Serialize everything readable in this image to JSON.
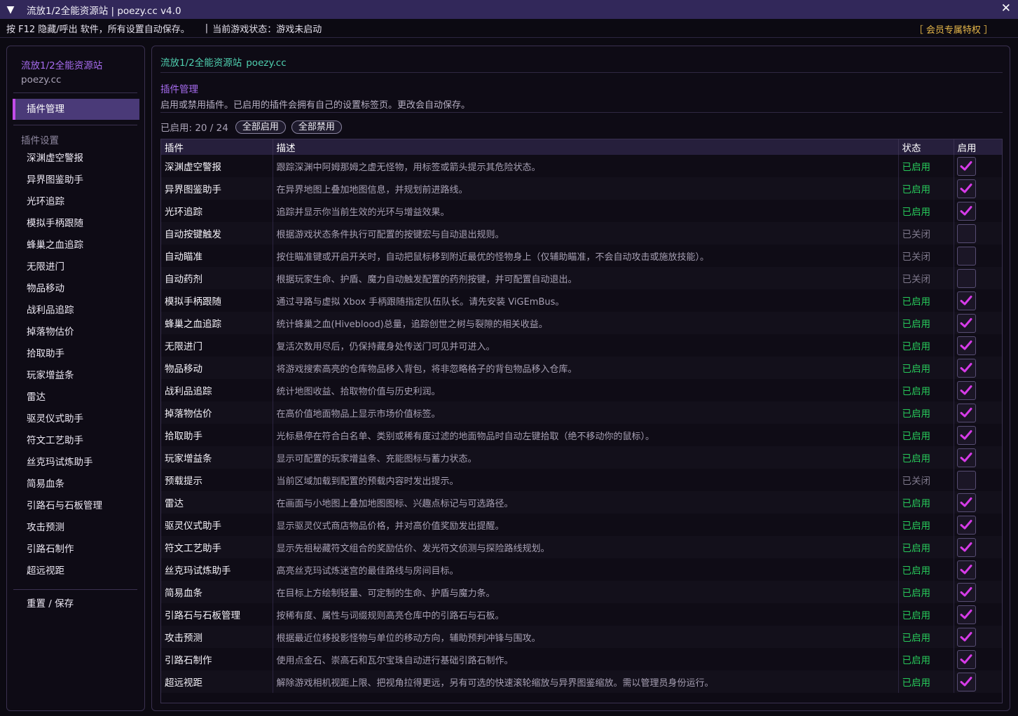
{
  "window": {
    "title": "流放1/2全能资源站  |  poezy.cc  v4.0",
    "close_glyph": "✕",
    "menu_glyph": "▼"
  },
  "infobar": {
    "hint": "按 F12 隐藏/呼出 软件，所有设置自动保存。",
    "separator": "|",
    "state": "当前游戏状态：游戏未启动",
    "member": "［ 会员专属特权 ］"
  },
  "sidebar": {
    "brand": "流放1/2全能资源站",
    "site": "poezy.cc",
    "active_item": "插件管理",
    "section_label": "插件设置",
    "items": [
      "深渊虚空警报",
      "异界图鉴助手",
      "光环追踪",
      "模拟手柄跟随",
      "蜂巢之血追踪",
      "无限进门",
      "物品移动",
      "战利品追踪",
      "掉落物估价",
      "拾取助手",
      "玩家增益条",
      "雷达",
      "驱灵仪式助手",
      "符文工艺助手",
      "丝克玛试炼助手",
      "简易血条",
      "引路石与石板管理",
      "攻击预测",
      "引路石制作",
      "超远视距"
    ],
    "reset_label": "重置 / 保存"
  },
  "main": {
    "brand": "流放1/2全能资源站",
    "site": "poezy.cc",
    "heading": "插件管理",
    "description": "启用或禁用插件。已启用的插件会拥有自己的设置标签页。更改会自动保存。",
    "enabled_count": "已启用: 20 / 24",
    "enable_all": "全部启用",
    "disable_all": "全部禁用"
  },
  "table": {
    "headers": {
      "plugin": "插件",
      "description": "描述",
      "status": "状态",
      "enable": "启用"
    },
    "colors": {
      "enabled": "#27c95a",
      "disabled": "#7f798c",
      "check": "#d63be8"
    },
    "rows": [
      {
        "name": "深渊虚空警报",
        "desc": "跟踪深渊中阿姆那姆之虚无怪物，用标签或箭头提示其危险状态。",
        "status": "已启用",
        "enabled": true
      },
      {
        "name": "异界图鉴助手",
        "desc": "在异界地图上叠加地图信息，并规划前进路线。",
        "status": "已启用",
        "enabled": true
      },
      {
        "name": "光环追踪",
        "desc": "追踪并显示你当前生效的光环与增益效果。",
        "status": "已启用",
        "enabled": true
      },
      {
        "name": "自动按键触发",
        "desc": "根据游戏状态条件执行可配置的按键宏与自动退出规则。",
        "status": "已关闭",
        "enabled": false
      },
      {
        "name": "自动瞄准",
        "desc": "按住瞄准键或开启开关时，自动把鼠标移到附近最优的怪物身上（仅辅助瞄准，不会自动攻击或施放技能）。",
        "status": "已关闭",
        "enabled": false
      },
      {
        "name": "自动药剂",
        "desc": "根据玩家生命、护盾、魔力自动触发配置的药剂按键，并可配置自动退出。",
        "status": "已关闭",
        "enabled": false
      },
      {
        "name": "模拟手柄跟随",
        "desc": "通过寻路与虚拟 Xbox 手柄跟随指定队伍队长。请先安装 ViGEmBus。",
        "status": "已启用",
        "enabled": true
      },
      {
        "name": "蜂巢之血追踪",
        "desc": "统计蜂巢之血(Hiveblood)总量，追踪创世之树与裂隙的相关收益。",
        "status": "已启用",
        "enabled": true
      },
      {
        "name": "无限进门",
        "desc": "复活次数用尽后，仍保持藏身处传送门可见并可进入。",
        "status": "已启用",
        "enabled": true
      },
      {
        "name": "物品移动",
        "desc": "将游戏搜索高亮的仓库物品移入背包，将非忽略格子的背包物品移入仓库。",
        "status": "已启用",
        "enabled": true
      },
      {
        "name": "战利品追踪",
        "desc": "统计地图收益、拾取物价值与历史利润。",
        "status": "已启用",
        "enabled": true
      },
      {
        "name": "掉落物估价",
        "desc": "在高价值地面物品上显示市场价值标签。",
        "status": "已启用",
        "enabled": true
      },
      {
        "name": "拾取助手",
        "desc": "光标悬停在符合白名单、类别或稀有度过滤的地面物品时自动左键拾取（绝不移动你的鼠标）。",
        "status": "已启用",
        "enabled": true
      },
      {
        "name": "玩家增益条",
        "desc": "显示可配置的玩家增益条、充能图标与蓄力状态。",
        "status": "已启用",
        "enabled": true
      },
      {
        "name": "预载提示",
        "desc": "当前区域加载到配置的预载内容时发出提示。",
        "status": "已关闭",
        "enabled": false
      },
      {
        "name": "雷达",
        "desc": "在画面与小地图上叠加地图图标、兴趣点标记与可选路径。",
        "status": "已启用",
        "enabled": true
      },
      {
        "name": "驱灵仪式助手",
        "desc": "显示驱灵仪式商店物品价格，并对高价值奖励发出提醒。",
        "status": "已启用",
        "enabled": true
      },
      {
        "name": "符文工艺助手",
        "desc": "显示先祖秘藏符文组合的奖励估价、发光符文侦测与探险路线规划。",
        "status": "已启用",
        "enabled": true
      },
      {
        "name": "丝克玛试炼助手",
        "desc": "高亮丝克玛试炼迷宫的最佳路线与房间目标。",
        "status": "已启用",
        "enabled": true
      },
      {
        "name": "简易血条",
        "desc": "在目标上方绘制轻量、可定制的生命、护盾与魔力条。",
        "status": "已启用",
        "enabled": true
      },
      {
        "name": "引路石与石板管理",
        "desc": "按稀有度、属性与词缀规则高亮仓库中的引路石与石板。",
        "status": "已启用",
        "enabled": true
      },
      {
        "name": "攻击预测",
        "desc": "根据最近位移投影怪物与单位的移动方向，辅助预判冲锋与围攻。",
        "status": "已启用",
        "enabled": true
      },
      {
        "name": "引路石制作",
        "desc": "使用点金石、崇高石和瓦尔宝珠自动进行基础引路石制作。",
        "status": "已启用",
        "enabled": true
      },
      {
        "name": "超远视距",
        "desc": "解除游戏相机视距上限、把视角拉得更远，另有可选的快速滚轮缩放与异界图鉴缩放。需以管理员身份运行。",
        "status": "已启用",
        "enabled": true
      }
    ]
  }
}
